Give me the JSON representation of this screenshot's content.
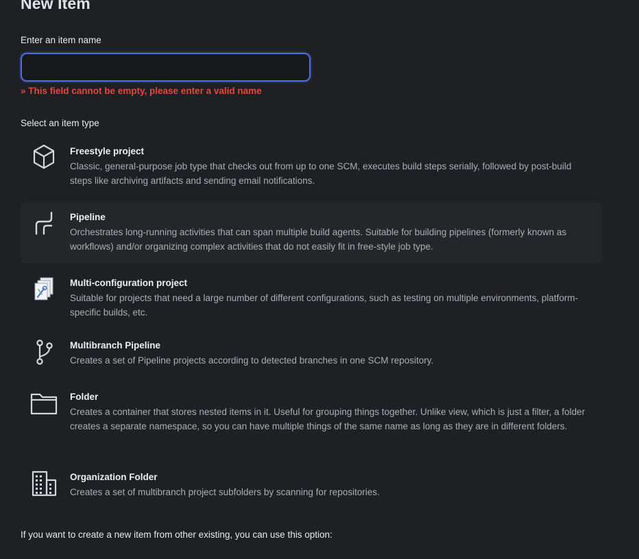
{
  "page": {
    "title": "New Item"
  },
  "name_field": {
    "label": "Enter an item name",
    "value": "",
    "placeholder": "",
    "error": "» This field cannot be empty, please enter a valid name"
  },
  "item_type": {
    "label": "Select an item type",
    "selected": "Pipeline",
    "items": [
      {
        "icon": "cube-icon",
        "title": "Freestyle project",
        "description": "Classic, general-purpose job type that checks out from up to one SCM, executes build steps serially, followed by post-build steps like archiving artifacts and sending email notifications."
      },
      {
        "icon": "pipeline-icon",
        "title": "Pipeline",
        "description": "Orchestrates long-running activities that can span multiple build agents. Suitable for building pipelines (formerly known as workflows) and/or organizing complex activities that do not easily fit in free-style job type."
      },
      {
        "icon": "multi-configuration-icon",
        "title": "Multi-configuration project",
        "description": "Suitable for projects that need a large number of different configurations, such as testing on multiple environments, platform-specific builds, etc."
      },
      {
        "icon": "git-branch-icon",
        "title": "Multibranch Pipeline",
        "description": "Creates a set of Pipeline projects according to detected branches in one SCM repository."
      },
      {
        "icon": "folder-icon",
        "title": "Folder",
        "description": "Creates a container that stores nested items in it. Useful for grouping things together. Unlike view, which is just a filter, a folder creates a separate namespace, so you can have multiple things of the same name as long as they are in different folders."
      },
      {
        "icon": "organization-building-icon",
        "title": "Organization Folder",
        "description": "Creates a set of multibranch project subfolders by scanning for repositories."
      }
    ]
  },
  "copy_option": {
    "text": "If you want to create a new item from other existing, you can use this option:"
  },
  "colors": {
    "background": "#1f2023",
    "error": "#e5473c",
    "input_focus": "#4f6ee0",
    "selected_row": "#25262a"
  }
}
